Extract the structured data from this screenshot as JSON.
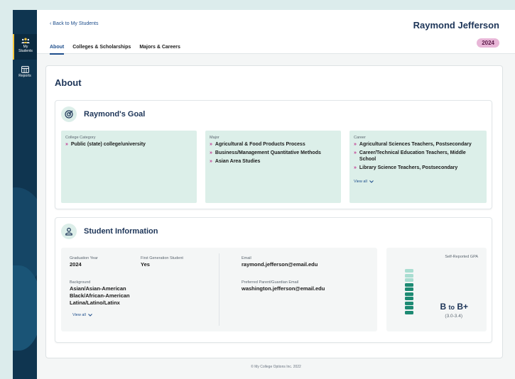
{
  "sidebar": {
    "items": [
      {
        "label_line1": "My",
        "label_line2": "Students",
        "icon": "students-icon",
        "active": true
      },
      {
        "label_line1": "Reports",
        "icon": "reports-icon",
        "active": false
      }
    ]
  },
  "header": {
    "back_link": "Back to My Students",
    "student_name": "Raymond Jefferson",
    "year_badge": "2024",
    "tabs": [
      {
        "label": "About",
        "active": true
      },
      {
        "label": "Colleges & Scholarships",
        "active": false
      },
      {
        "label": "Majors & Careers",
        "active": false
      }
    ]
  },
  "about": {
    "title": "About",
    "goal": {
      "title": "Raymond's Goal",
      "college_category": {
        "label": "College Category",
        "items": [
          "Public (state) college/university"
        ]
      },
      "major": {
        "label": "Major",
        "items": [
          "Agricultural & Food Products Process",
          "Business/Management Quantitative Methods",
          "Asian Area Studies"
        ]
      },
      "career": {
        "label": "Career",
        "items": [
          "Agricultural Sciences Teachers, Postsecondary",
          "Career/Technical Education Teachers, Middle School",
          "Library Science Teachers, Postsecondary"
        ],
        "view_all": "View all"
      }
    },
    "student_info": {
      "title": "Student Information",
      "graduation_year": {
        "label": "Graduation Year",
        "value": "2024"
      },
      "first_generation": {
        "label": "First Generation Student",
        "value": "Yes"
      },
      "email": {
        "label": "Email",
        "value": "raymond.jefferson@email.edu"
      },
      "parent_email": {
        "label": "Preferred Parent/Guardian Email",
        "value": "washington.jefferson@email.edu"
      },
      "background": {
        "label": "Background",
        "items": [
          "Asian/Asian-American",
          "Black/African-American",
          "Latina/Latino/Latinx"
        ],
        "view_all": "View all"
      },
      "gpa": {
        "label": "Self-Reported GPA",
        "value_low": "B",
        "value_to": "to",
        "value_high": "B+",
        "range": "(3.0-3.4)",
        "level_fraction": 0.7
      }
    }
  },
  "footer": {
    "text": "© My College Options Inc. 2022"
  },
  "colors": {
    "primary": "#1d3558",
    "accent": "#c0348e",
    "goal_bg": "#dcefe9",
    "sidebar": "#0f3550",
    "badge": "#e8b6d7"
  }
}
